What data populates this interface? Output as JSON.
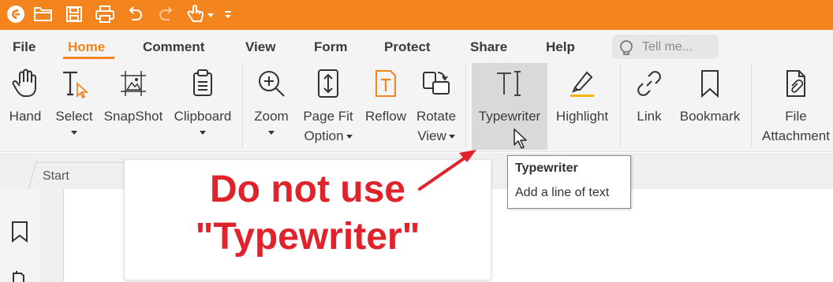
{
  "menu": {
    "tabs": [
      {
        "label": "File"
      },
      {
        "label": "Home"
      },
      {
        "label": "Comment"
      },
      {
        "label": "View"
      },
      {
        "label": "Form"
      },
      {
        "label": "Protect"
      },
      {
        "label": "Share"
      },
      {
        "label": "Help"
      }
    ],
    "active_tab": "Home",
    "tell_me_placeholder": "Tell me..."
  },
  "ribbon": {
    "hand": "Hand",
    "select": "Select",
    "snapshot": "SnapShot",
    "clipboard": "Clipboard",
    "zoom": "Zoom",
    "page_fit_line1": "Page Fit",
    "page_fit_line2": "Option",
    "reflow": "Reflow",
    "rotate_line1": "Rotate",
    "rotate_line2": "View",
    "typewriter": "Typewriter",
    "highlight": "Highlight",
    "link": "Link",
    "bookmark": "Bookmark",
    "file_attachment_line1": "File",
    "file_attachment_line2": "Attachment"
  },
  "document_tab": {
    "label": "Start"
  },
  "tooltip": {
    "title": "Typewriter",
    "description": "Add a line of text"
  },
  "annotation": {
    "line1": "Do not use",
    "line2": "\"Typewriter\""
  },
  "colors": {
    "brand": "#f3841e",
    "annotation_text": "#e0222a",
    "arrow": "#e0222a",
    "highlight_underline": "#f6b400"
  }
}
